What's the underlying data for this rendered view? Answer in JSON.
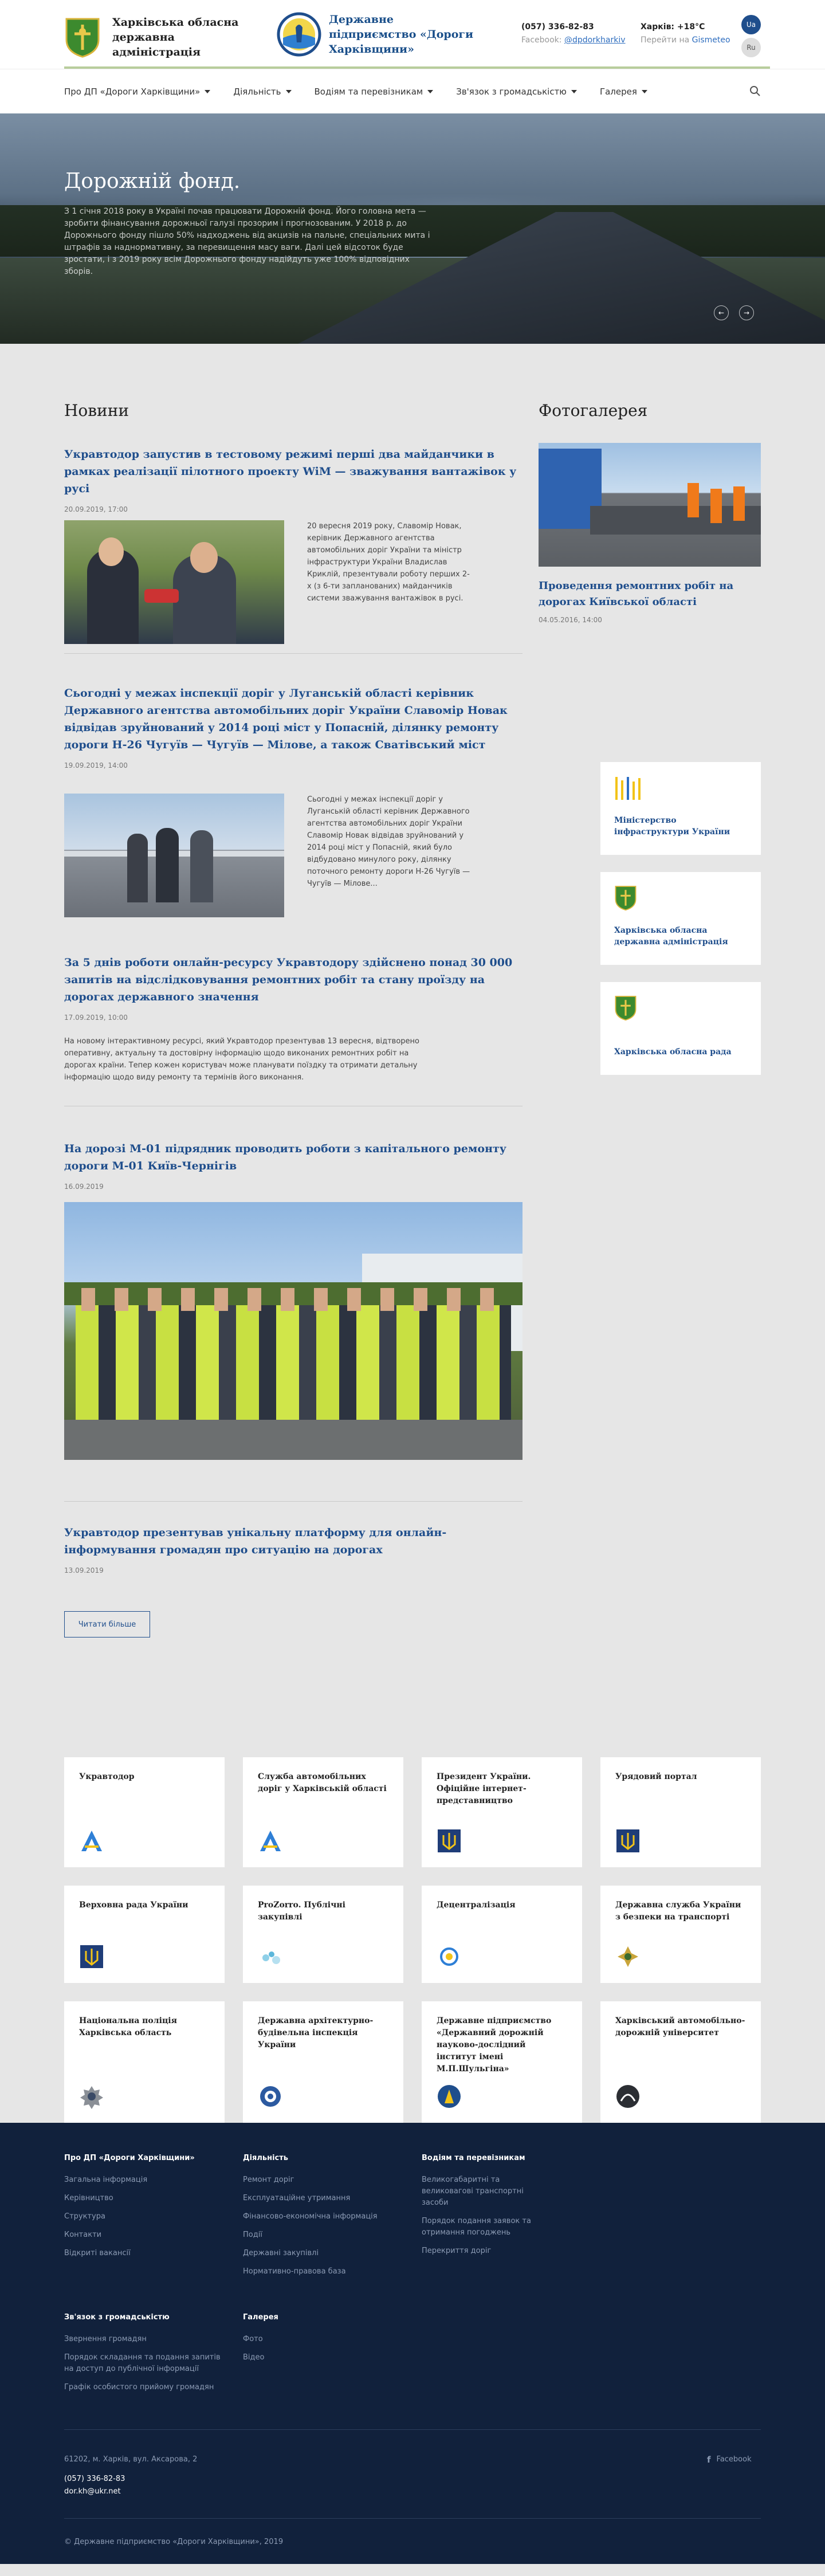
{
  "header": {
    "logo1_text": "Харківська обласна державна адміністрація",
    "logo2_text": "Державне підприємство «Дороги Харківщини»",
    "phone": "(057) 336-82-83",
    "facebook_label": "Facebook:",
    "facebook_handle": "@dpdorkharkiv",
    "weather_city": "Харків: +18°C",
    "weather_prefix": "Перейти на",
    "weather_link": "Gismeteo",
    "lang_ua": "Ua",
    "lang_ru": "Ru"
  },
  "nav": {
    "items": [
      "Про ДП «Дороги Харківщини»",
      "Діяльність",
      "Водіям та перевізникам",
      "Зв'язок з громадськістю",
      "Галерея"
    ]
  },
  "hero": {
    "title": "Дорожній фонд.",
    "text": "З 1 січня 2018 року в Україні почав працювати Дорожній фонд. Його головна мета — зробити фінансування дорожньої галузі прозорим і прогнозованим. У 2018 р. до Дорожнього фонду пішло 50% надходжень від акцизів на пальне, спеціальних мита і штрафів за наднормативну, за перевищення масу ваги. Далі цей відсоток буде зростати, і з 2019 року всім Дорожнього фонду надійдуть уже 100% відповідних зборів."
  },
  "news": {
    "heading": "Новини",
    "items": [
      {
        "title": "Укравтодор запустив в тестовому режимі перші два майданчики в рамках реалізації пілотного проекту WiM — зважування вантажівок у русі",
        "date": "20.09.2019, 17:00",
        "text": "20 вересня 2019 року, Славомір Новак, керівник Державного агентства автомобільних доріг України та міністр інфраструктури України Владислав Криклій, презентували роботу перших 2-х (з 6-ти запланованих) майданчиків системи зважування вантажівок в русі."
      },
      {
        "title": "Сьогодні у межах інспекції доріг у Луганській області керівник Державного агентства автомобільних доріг України Славомір Новак відвідав зруйнований у 2014 році міст у Попасній, ділянку ремонту дороги Н-26 Чугуїв — Чугуїв — Мілове, а також Сватівський міст",
        "date": "19.09.2019, 14:00",
        "text": "Сьогодні у межах інспекції доріг у Луганській області керівник Державного агентства автомобільних доріг України Славомір Новак відвідав зруйнований у 2014 році міст у Попасній, який було відбудовано минулого року, ділянку поточного ремонту дороги Н-26 Чугуїв — Чугуїв — Мілове..."
      },
      {
        "title": "За 5 днів роботи онлайн-ресурсу Укравтодору здійснено понад 30 000 запитів на відслідковування ремонтних робіт та стану проїзду на дорогах державного значення",
        "date": "17.09.2019, 10:00",
        "text": "На новому інтерактивному ресурсі, який Укравтодор презентував 13 вересня, відтворено оперативну, актуальну та достовірну інформацію щодо виконаних ремонтних робіт на дорогах країни. Тепер кожен користувач може планувати поїздку та отримати детальну інформацію щодо виду ремонту та термінів його виконання."
      },
      {
        "title": "На дорозі М-01 підрядник проводить роботи з капітального ремонту дороги М-01 Київ-Чернігів",
        "date": "16.09.2019",
        "text": ""
      },
      {
        "title": "Укравтодор презентував унікальну платформу для онлайн-інформування громадян про ситуацію на дорогах",
        "date": "13.09.2019",
        "text": ""
      }
    ],
    "more_button": "Читати більше"
  },
  "gallery": {
    "heading": "Фотогалерея",
    "title": "Проведення ремонтних робіт на дорогах Київської області",
    "date": "04.05.2016, 14:00"
  },
  "side_links": [
    {
      "label": "Міністерство інфраструктури України",
      "icon": "ministry-logo-icon"
    },
    {
      "label": "Харківська обласна державна адміністрація",
      "icon": "kharkiv-coat-of-arms-icon"
    },
    {
      "label": "Харківська обласна рада",
      "icon": "kharkiv-coat-of-arms-icon"
    }
  ],
  "partners": [
    {
      "label": "Укравтодор",
      "icon": "ukravtodor-logo-icon"
    },
    {
      "label": "Служба автомобільних доріг у Харківській області",
      "icon": "ukravtodor-logo-icon"
    },
    {
      "label": "Президент України. Офіційне інтернет-представництво",
      "icon": "trident-icon"
    },
    {
      "label": "Урядовий портал",
      "icon": "trident-icon"
    },
    {
      "label": "Верховна рада України",
      "icon": "trident-icon"
    },
    {
      "label": "ProZorro. Публічні закупівлі",
      "icon": "prozorro-logo-icon"
    },
    {
      "label": "Децентралізація",
      "icon": "decentralization-logo-icon"
    },
    {
      "label": "Державна служба України з безпеки на транспорті",
      "icon": "transport-safety-emblem-icon"
    },
    {
      "label": "Національна поліція Харківська область",
      "icon": "police-badge-icon"
    },
    {
      "label": "Державна архітектурно-будівельна інспекція України",
      "icon": "dabi-logo-icon"
    },
    {
      "label": "Державне підприємство «Державний дорожній науково-дослідний інститут імені М.П.Шульгіна»",
      "icon": "dorndi-logo-icon"
    },
    {
      "label": "Харківський автомобільно-дорожній університет",
      "icon": "khadi-logo-icon"
    }
  ],
  "footer": {
    "cols": [
      {
        "heading": "Про ДП «Дороги Харківщини»",
        "items": [
          "Загальна інформація",
          "Керівництво",
          "Структура",
          "Контакти",
          "Відкриті вакансії"
        ]
      },
      {
        "heading": "Діяльність",
        "items": [
          "Ремонт доріг",
          "Експлуатаційне утримання",
          "Фінансово-економічна інформація",
          "Події",
          "Державні закупівлі",
          "Нормативно-правова база"
        ]
      },
      {
        "heading": "Водіям та перевізникам",
        "items": [
          "Великогабаритні та великовагові транспортні засоби",
          "Порядок подання заявок та отримання погоджень",
          "Перекриття доріг"
        ]
      },
      {
        "heading": "Зв'язок з громадськістю",
        "items": [
          "Звернення громадян",
          "Порядок складання та подання запитів на доступ до публічної інформації",
          "Графік особистого прийому громадян"
        ]
      },
      {
        "heading": "Галерея",
        "items": [
          "Фото",
          "Відео"
        ]
      }
    ],
    "address": "61202, м. Харків, вул. Аксарова, 2",
    "phone": "(057) 336-82-83",
    "email": "dor.kh@ukr.net",
    "facebook": "Facebook",
    "copyright": "© Державне підприємство «Дороги Харківщини», 2019"
  }
}
